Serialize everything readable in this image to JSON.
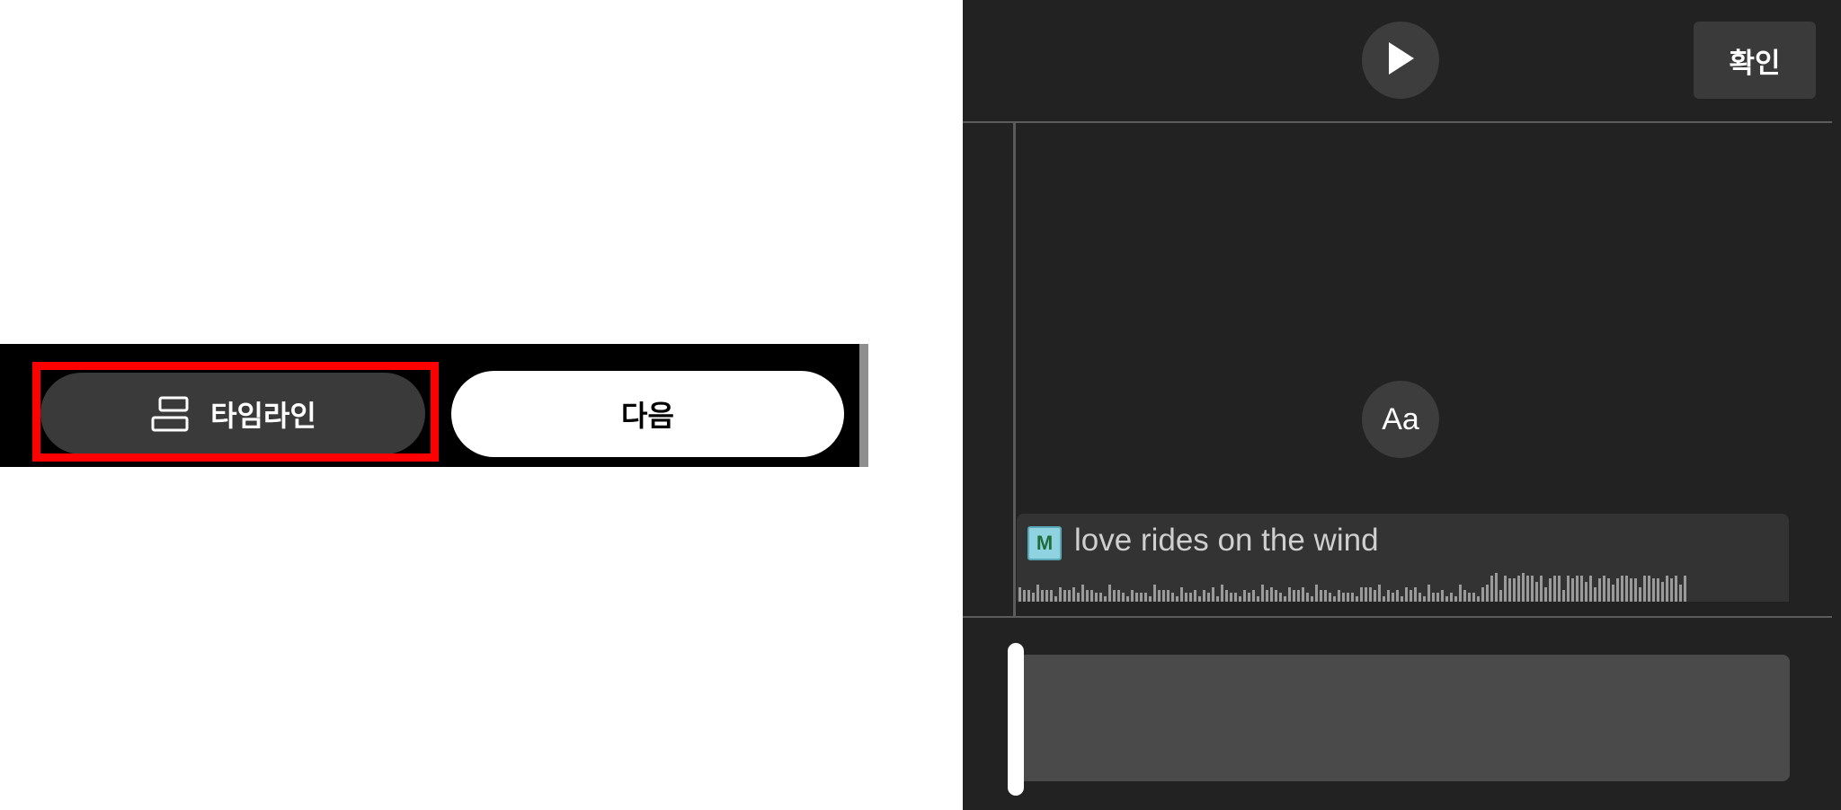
{
  "left_toolbar": {
    "timeline_button": {
      "label": "타임라인",
      "icon": "timeline-icon"
    },
    "next_button": {
      "label": "다음"
    }
  },
  "editor": {
    "play_button": {
      "icon": "play-icon"
    },
    "confirm_button": {
      "label": "확인"
    },
    "text_button": {
      "label": "Aa"
    },
    "audio_track": {
      "title": "love rides on the wind",
      "thumbnail_icon": "album-art-icon",
      "thumbnail_glyph": "M"
    },
    "waveform_levels": [
      0.5,
      0.4,
      0.4,
      0.3,
      0.6,
      0.4,
      0.4,
      0.4,
      0.2,
      0.5,
      0.4,
      0.4,
      0.5,
      0.3,
      0.6,
      0.4,
      0.4,
      0.3,
      0.3,
      0.2,
      0.6,
      0.4,
      0.4,
      0.3,
      0.2,
      0.4,
      0.3,
      0.3,
      0.3,
      0.2,
      0.6,
      0.4,
      0.4,
      0.4,
      0.3,
      0.2,
      0.5,
      0.3,
      0.3,
      0.4,
      0.2,
      0.4,
      0.3,
      0.5,
      0.2,
      0.6,
      0.4,
      0.3,
      0.3,
      0.2,
      0.4,
      0.3,
      0.4,
      0.2,
      0.6,
      0.4,
      0.5,
      0.4,
      0.3,
      0.2,
      0.5,
      0.4,
      0.4,
      0.5,
      0.3,
      0.2,
      0.6,
      0.4,
      0.4,
      0.3,
      0.2,
      0.4,
      0.3,
      0.3,
      0.3,
      0.2,
      0.5,
      0.5,
      0.5,
      0.4,
      0.6,
      0.2,
      0.4,
      0.3,
      0.4,
      0.2,
      0.5,
      0.4,
      0.5,
      0.3,
      0.2,
      0.6,
      0.3,
      0.3,
      0.4,
      0.2,
      0.3,
      0.2,
      0.6,
      0.4,
      0.3,
      0.3,
      0.2,
      0.5,
      0.6,
      0.9,
      1.0,
      0.4,
      0.9,
      0.8,
      0.8,
      0.9,
      1.0,
      0.9,
      0.9,
      0.7,
      0.9,
      0.5,
      0.8,
      0.9,
      0.9,
      0.4,
      0.9,
      0.8,
      0.9,
      0.9,
      0.7,
      0.9,
      0.5,
      0.8,
      0.9,
      0.8,
      0.6,
      0.8,
      0.9,
      0.9,
      0.8,
      0.8,
      0.5,
      0.9,
      0.9,
      0.8,
      0.8,
      0.7,
      0.9,
      0.8,
      0.9,
      0.6,
      0.9
    ],
    "colors": {
      "panel_bg": "#222222",
      "highlight": "#ff0000",
      "button_dark": "#3a3a3a"
    }
  }
}
